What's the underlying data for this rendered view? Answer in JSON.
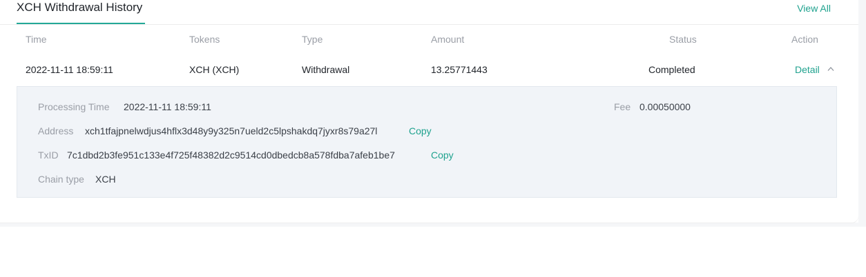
{
  "header": {
    "title": "XCH Withdrawal History",
    "view_all": "View All"
  },
  "table": {
    "columns": {
      "time": "Time",
      "tokens": "Tokens",
      "type": "Type",
      "amount": "Amount",
      "status": "Status",
      "action": "Action"
    },
    "rows": [
      {
        "time": "2022-11-11 18:59:11",
        "tokens": "XCH (XCH)",
        "type": "Withdrawal",
        "amount": "13.25771443",
        "status": "Completed",
        "action": "Detail",
        "expanded": true
      }
    ]
  },
  "detail": {
    "processing_time_label": "Processing Time",
    "processing_time_value": "2022-11-11 18:59:11",
    "fee_label": "Fee",
    "fee_value": "0.00050000",
    "address_label": "Address",
    "address_value": "xch1tfajpnelwdjus4hflx3d48y9y325n7ueld2c5lpshakdq7jyxr8s79a27l",
    "txid_label": "TxID",
    "txid_value": "7c1dbd2b3fe951c133e4f725f48382d2c9514cd0dbedcb8a578fdba7afeb1be7",
    "chain_type_label": "Chain type",
    "chain_type_value": "XCH",
    "copy_label": "Copy"
  },
  "colors": {
    "accent": "#1fa28e",
    "text": "#1f2329",
    "muted": "#9a9ea6",
    "panel_bg": "#f1f4f8"
  },
  "icons": {
    "expand": "chevron-up-icon"
  }
}
